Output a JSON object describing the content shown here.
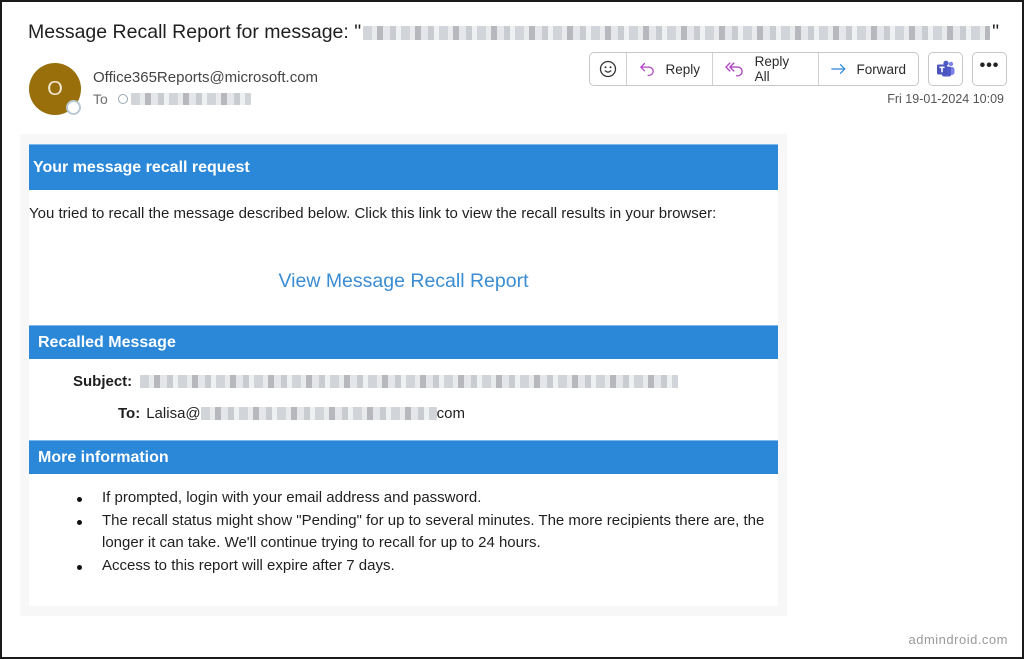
{
  "email": {
    "subject_prefix": "Message Recall Report for message: \"",
    "subject_suffix": "\"",
    "subject_redacted": true,
    "sender": {
      "avatar_initial": "O",
      "avatar_color": "#986f0b",
      "address": "Office365Reports@microsoft.com"
    },
    "to_label": "To",
    "timestamp": "Fri 19-01-2024 10:09"
  },
  "toolbar": {
    "emoji_icon": "smiley-icon",
    "reply_label": "Reply",
    "reply_all_label": "Reply All",
    "forward_label": "Forward",
    "teams_icon": "teams-icon",
    "more_label": "•••",
    "reply_color": "#b146c2",
    "forward_color": "#2b88d8"
  },
  "body": {
    "accent_color": "#2b88d8",
    "section_recall_request": {
      "heading": "Your message recall request",
      "text": " You tried to recall the message described below. Click this link to view the recall results in your browser:",
      "link_label": "View Message Recall Report"
    },
    "section_recalled_message": {
      "heading": "Recalled Message",
      "subject_label": "Subject:",
      "to_label": "To:",
      "to_prefix": "Lalisa@",
      "to_suffix": "com"
    },
    "section_more_info": {
      "heading": "More information",
      "items": [
        "If prompted, login with your email address and password.",
        "The recall status might show \"Pending\" for up to several minutes. The more recipients there are, the longer it can take. We'll continue trying to recall for up to 24 hours.",
        "Access to this report will expire after 7 days."
      ]
    }
  },
  "watermark": "admindroid.com"
}
